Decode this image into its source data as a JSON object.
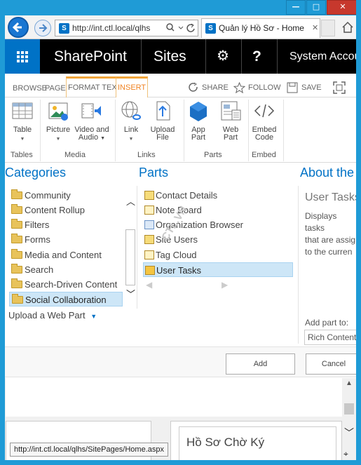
{
  "browser": {
    "window_buttons": {
      "minimize": "—",
      "maximize": "□",
      "close": "✕"
    },
    "url": "http://int.ctl.local/qlhs",
    "tab_title": "Quản lý Hồ Sơ - Home",
    "status_url": "http://int.ctl.local/qlhs/SitePages/Home.aspx"
  },
  "suitebar": {
    "app_name": "SharePoint",
    "sites_label": "Sites",
    "gear_glyph": "⚙",
    "help_glyph": "?",
    "user": "System Account"
  },
  "ribbon": {
    "tabs": [
      {
        "label": "BROWSE"
      },
      {
        "label": "PAGE"
      },
      {
        "label": "FORMAT TEXT"
      },
      {
        "label": "INSERT"
      }
    ],
    "commands": {
      "share": "SHARE",
      "follow": "FOLLOW",
      "save": "SAVE"
    },
    "buttons": {
      "table": "Table",
      "picture": "Picture",
      "video_audio_1": "Video and",
      "video_audio_2": "Audio",
      "link": "Link",
      "upload_1": "Upload",
      "upload_2": "File",
      "app_part_1": "App",
      "app_part_2": "Part",
      "web_part_1": "Web",
      "web_part_2": "Part",
      "embed_1": "Embed",
      "embed_2": "Code"
    },
    "groups": {
      "tables": "Tables",
      "media": "Media",
      "links": "Links",
      "parts": "Parts",
      "embed": "Embed"
    }
  },
  "adder": {
    "categories_title": "Categories",
    "parts_title": "Parts",
    "about_title": "About the part",
    "categories": [
      "Community",
      "Content Rollup",
      "Filters",
      "Forms",
      "Media and Content",
      "Search",
      "Search-Driven Content",
      "Social Collaboration"
    ],
    "selected_category": "Social Collaboration",
    "upload_label": "Upload a Web Part",
    "parts": [
      "Contact Details",
      "Note Board",
      "Organization Browser",
      "Site Users",
      "Tag Cloud",
      "User Tasks"
    ],
    "selected_part": "User Tasks",
    "watermark": "CTL.VN",
    "about": {
      "name": "User Tasks",
      "description": "Displays tasks\nthat are assig\nto the curren\nuser.",
      "add_part_to": "Add part to:",
      "zone": "Rich Content"
    },
    "add_button": "Add",
    "cancel_button": "Cancel"
  },
  "page": {
    "heading": "Hồ Sơ Chờ Ký"
  }
}
